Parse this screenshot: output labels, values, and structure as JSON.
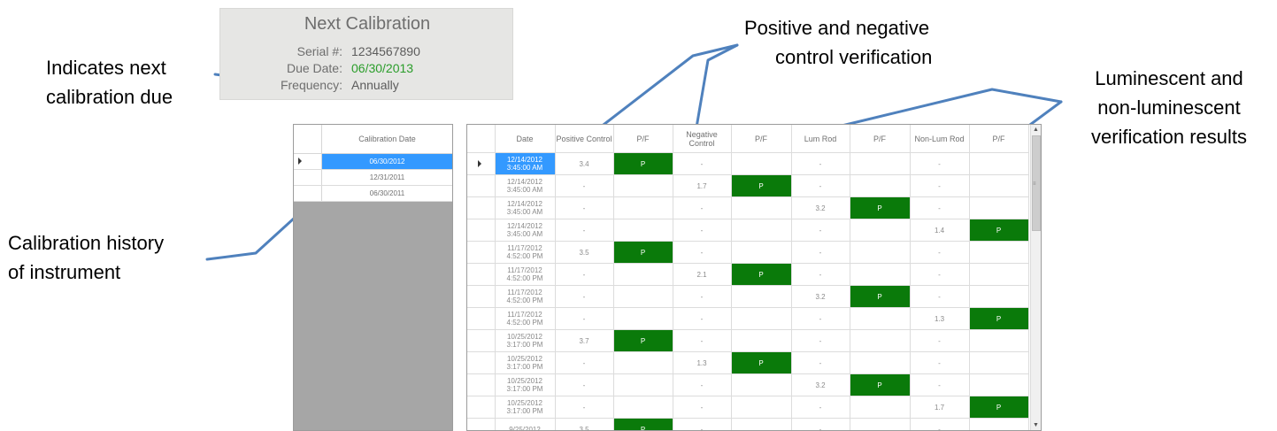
{
  "annotations": {
    "next_due": [
      "Indicates next",
      "calibration due"
    ],
    "history": [
      "Calibration history",
      "of instrument"
    ],
    "pos_neg": [
      "Positive and negative",
      "control verification"
    ],
    "lum": [
      "Luminescent and",
      "non-luminescent",
      "verification results"
    ]
  },
  "next_calibration": {
    "title": "Next Calibration",
    "serial_label": "Serial #:",
    "serial_value": "1234567890",
    "due_label": "Due Date:",
    "due_value": "06/30/2013",
    "frequency_label": "Frequency:",
    "frequency_value": "Annually",
    "due_color": "#2a9d2a"
  },
  "history": {
    "header": "Calibration Date",
    "rows": [
      "06/30/2012",
      "12/31/2011",
      "06/30/2011"
    ],
    "selected_index": 0
  },
  "results": {
    "headers": [
      "Date",
      "Positive Control",
      "P/F",
      "Negative Control",
      "P/F",
      "Lum Rod",
      "P/F",
      "Non-Lum Rod",
      "P/F"
    ],
    "rows": [
      {
        "date": "12/14/2012 3:45:00 AM",
        "cells": [
          "3.4",
          "P",
          "-",
          "",
          "-",
          "",
          "-",
          ""
        ]
      },
      {
        "date": "12/14/2012 3:45:00 AM",
        "cells": [
          "-",
          "",
          "1.7",
          "P",
          "-",
          "",
          "-",
          ""
        ]
      },
      {
        "date": "12/14/2012 3:45:00 AM",
        "cells": [
          "-",
          "",
          "-",
          "",
          "3.2",
          "P",
          "-",
          ""
        ]
      },
      {
        "date": "12/14/2012 3:45:00 AM",
        "cells": [
          "-",
          "",
          "-",
          "",
          "-",
          "",
          "1.4",
          "P"
        ]
      },
      {
        "date": "11/17/2012 4:52:00 PM",
        "cells": [
          "3.5",
          "P",
          "-",
          "",
          "-",
          "",
          "-",
          ""
        ]
      },
      {
        "date": "11/17/2012 4:52:00 PM",
        "cells": [
          "-",
          "",
          "2.1",
          "P",
          "-",
          "",
          "-",
          ""
        ]
      },
      {
        "date": "11/17/2012 4:52:00 PM",
        "cells": [
          "-",
          "",
          "-",
          "",
          "3.2",
          "P",
          "-",
          ""
        ]
      },
      {
        "date": "11/17/2012 4:52:00 PM",
        "cells": [
          "-",
          "",
          "-",
          "",
          "-",
          "",
          "1.3",
          "P"
        ]
      },
      {
        "date": "10/25/2012 3:17:00 PM",
        "cells": [
          "3.7",
          "P",
          "-",
          "",
          "-",
          "",
          "-",
          ""
        ]
      },
      {
        "date": "10/25/2012 3:17:00 PM",
        "cells": [
          "-",
          "",
          "1.3",
          "P",
          "-",
          "",
          "-",
          ""
        ]
      },
      {
        "date": "10/25/2012 3:17:00 PM",
        "cells": [
          "-",
          "",
          "-",
          "",
          "3.2",
          "P",
          "-",
          ""
        ]
      },
      {
        "date": "10/25/2012 3:17:00 PM",
        "cells": [
          "-",
          "",
          "-",
          "",
          "-",
          "",
          "1.7",
          "P"
        ]
      },
      {
        "date": "9/25/2012",
        "cells": [
          "3.5",
          "P",
          "-",
          "",
          "-",
          "",
          "-",
          ""
        ]
      }
    ],
    "selected_index": 0,
    "pass_color": "#0a7a0a",
    "selection_color": "#3399ff"
  },
  "scrollbar": {
    "up_icon": "▲",
    "down_icon": "▼",
    "grip_icon": "≡"
  },
  "arrow_color": "#4f81bd"
}
